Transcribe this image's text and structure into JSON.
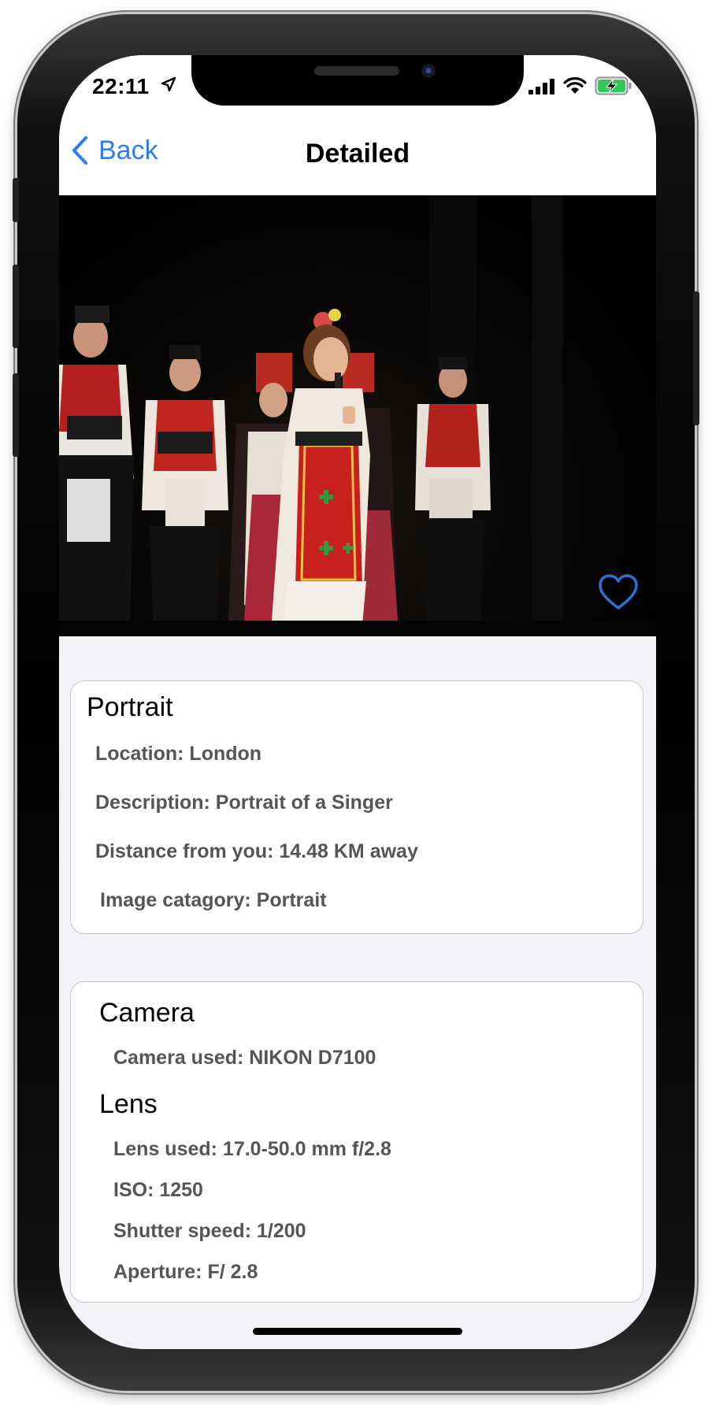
{
  "status_bar": {
    "time": "22:11"
  },
  "nav": {
    "back_label": "Back",
    "title": "Detailed"
  },
  "image": {
    "favorited": false
  },
  "info_card": {
    "title": "Portrait",
    "location": "Location: London",
    "description": "Description: Portrait of a Singer",
    "distance": "Distance from you: 14.48 KM away",
    "category": "Image catagory: Portrait"
  },
  "camera_card": {
    "camera_heading": "Camera",
    "camera_used": "Camera used: NIKON D7100",
    "lens_heading": "Lens",
    "lens_used": "Lens used: 17.0-50.0 mm f/2.8",
    "iso": "ISO: 1250",
    "shutter": "Shutter speed: 1/200",
    "aperture": "Aperture: F/ 2.8"
  },
  "colors": {
    "accent": "#2f7bf5",
    "heart": "#2f6fd8"
  }
}
